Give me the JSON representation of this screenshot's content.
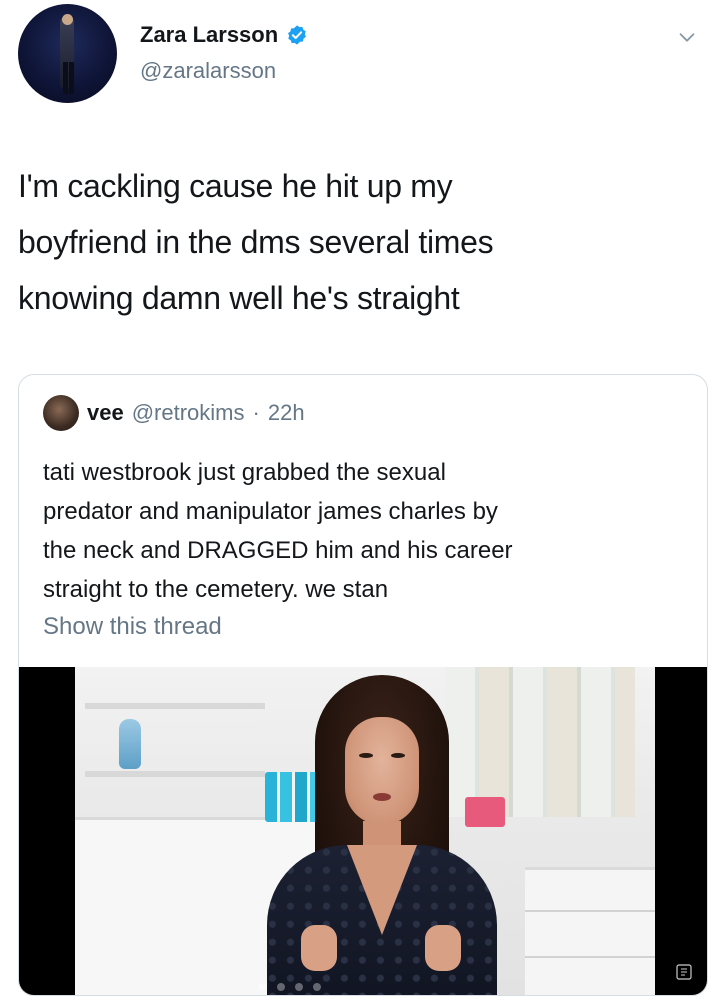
{
  "author": {
    "display_name": "Zara Larsson",
    "handle": "@zaralarsson",
    "verified": true
  },
  "tweet": {
    "lines": [
      "I'm cackling cause he hit up my",
      "boyfriend in the dms several times",
      "knowing damn well he's straight"
    ]
  },
  "quote": {
    "name": "vee",
    "handle": "@retrokims",
    "separator": "·",
    "time": "22h",
    "lines": [
      "tati westbrook just grabbed the  sexual",
      "predator and manipulator james charles by",
      "the neck and DRAGGED him and his career",
      "straight to the cemetery. we stan"
    ],
    "show_thread": "Show this thread"
  },
  "icons": {
    "verified": "verified-badge-icon",
    "menu": "chevron-down-icon"
  },
  "colors": {
    "text": "#14171a",
    "secondary": "#657786",
    "verified": "#1da1f2",
    "border": "#d6dde3"
  }
}
